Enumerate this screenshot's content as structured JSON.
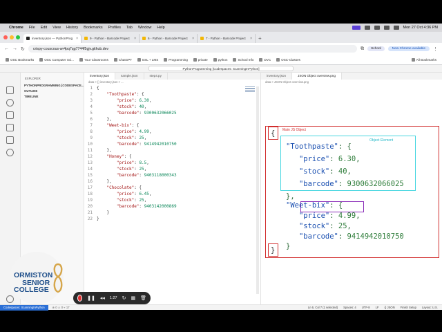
{
  "menubar": {
    "app": "Chrome",
    "items": [
      "File",
      "Edit",
      "View",
      "History",
      "Bookmarks",
      "Profiles",
      "Tab",
      "Window",
      "Help"
    ],
    "clock": "Mon 27 Oct  4:36 PM"
  },
  "browser": {
    "tabs": [
      {
        "label": "inventory.json — PythonProg",
        "active": true
      },
      {
        "label": "9 - Python - Barcode Project",
        "active": false
      },
      {
        "label": "6 - Python - Barcode Project",
        "active": false
      },
      {
        "label": "7 - Python - Barcode Project",
        "active": false
      }
    ],
    "url": "crispy-couscous-wr4pq7qg7744f5gjv.github.dev",
    "profile": "School",
    "update_label": "New Chrome available",
    "bookmarks": [
      "OSC Bookmarks",
      "OSC Computer Sci...",
      "Your Classrooms",
      "ChatGPT",
      "ESL + LMS",
      "Programming",
      "private",
      "python",
      "School Info",
      "DVC",
      "OSC-Classes"
    ],
    "all_bookmarks": "All Bookmarks"
  },
  "vscode": {
    "command_center": "PythonProgramming [Codespaces: ScanningInPython]",
    "explorer_title": "EXPLORER",
    "sidebar_rows": [
      "PYTHONPROGRAMMING [CODESPACE...",
      "OUTLINE",
      "TIMELINE"
    ],
    "editor_tabs": [
      "inventory.json",
      "sample.json",
      "step4.py"
    ],
    "editor_crumb": "data > {} inventory.json > ...",
    "preview_tabs": [
      "inventory.json",
      "JSON Object overview.png"
    ],
    "preview_crumb": "data > JSON Object overview.png",
    "code_lines": [
      {
        "n": "1",
        "t": "{"
      },
      {
        "n": "2",
        "t": "    \"Toothpaste\": {"
      },
      {
        "n": "3",
        "t": "        \"price\": 6.30,"
      },
      {
        "n": "4",
        "t": "        \"stock\": 40,"
      },
      {
        "n": "5",
        "t": "        \"barcode\": 9300632066025"
      },
      {
        "n": "6",
        "t": "    },"
      },
      {
        "n": "7",
        "t": "    \"Weet-bix\": {"
      },
      {
        "n": "8",
        "t": "        \"price\": 4.99,"
      },
      {
        "n": "9",
        "t": "        \"stock\": 25,"
      },
      {
        "n": "10",
        "t": "        \"barcode\": 9414942010750"
      },
      {
        "n": "11",
        "t": "    },"
      },
      {
        "n": "12",
        "t": "    \"Honey\": {"
      },
      {
        "n": "13",
        "t": "        \"price\": 8.5,"
      },
      {
        "n": "14",
        "t": "        \"stock\": 25,"
      },
      {
        "n": "15",
        "t": "        \"barcode\": 9403118000343"
      },
      {
        "n": "16",
        "t": "    },"
      },
      {
        "n": "17",
        "t": "    \"Chocolate\": {"
      },
      {
        "n": "18",
        "t": "        \"price\": 6.45,"
      },
      {
        "n": "19",
        "t": "        \"stock\": 25,"
      },
      {
        "n": "20",
        "t": "        \"barcode\": 9403142000869"
      },
      {
        "n": "21",
        "t": "    }"
      },
      {
        "n": "22",
        "t": "}"
      }
    ],
    "overview": {
      "main_label": "Main JS Object",
      "object_label": "Object Element",
      "open_brace": "{",
      "close_brace": "}",
      "lines": [
        "\"Toothpaste\": {",
        "   \"price\": 6.30,",
        "   \"stock\": 40,",
        "   \"barcode\": 9300632066025",
        "},",
        "\"Weet-bix\": {",
        "   \"price\": 4.99,",
        "   \"stock\": 25,",
        "   \"barcode\": 9414942010750",
        "}"
      ]
    },
    "status": {
      "remote": "Codespaces: ScanningInPython",
      "problems": "⊗ 0 ⚠ 0  ⑂ 17",
      "cursor": "Ln 6, Col 7 (1 selected)",
      "spaces": "Spaces: 4",
      "encoding": "UTF-8",
      "eol": "LF",
      "language": "{} JSON",
      "tool": "Finish Setup",
      "layout": "Layout: U.S."
    }
  },
  "logo": {
    "line1": "ORMISTON",
    "line2": "SENIOR",
    "line3": "COLLEGE"
  },
  "recorder": {
    "time": "1:27"
  },
  "colors": {
    "accent_red": "#d12c2c",
    "accent_cyan": "#44d6e0",
    "accent_purple": "#8a2bb8",
    "logo_blue": "#1f4f8a",
    "logo_gold": "#d6a64a"
  }
}
